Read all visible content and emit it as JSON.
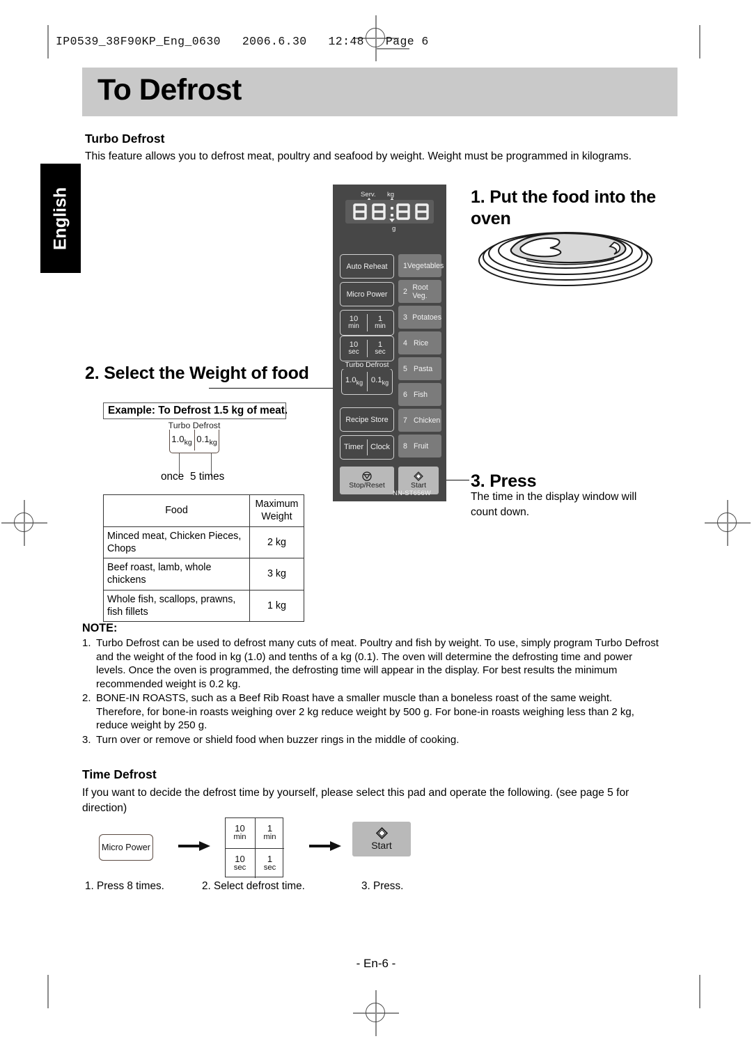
{
  "print_slug": "IP0539_38F90KP_Eng_0630   2006.6.30   12:48   Page 6",
  "page_title": "To Defrost",
  "language_tab": "English",
  "sections": {
    "turbo_defrost_heading": "Turbo Defrost",
    "turbo_defrost_intro": "This feature allows you to defrost meat, poultry and seafood by weight. Weight must be programmed in kilograms.",
    "time_defrost_heading": "Time Defrost",
    "time_defrost_intro": "If you want to decide the defrost time by yourself, please select this pad and operate the following. (see page 5 for direction)"
  },
  "steps": {
    "step1": "1. Put the food into the oven",
    "step2": "2. Select the Weight of food",
    "step3_title": "3. Press",
    "step3_body": "The time in the display window will count down."
  },
  "example": {
    "box_label": "Example: To Defrost 1.5 kg of meat.",
    "key_caption": "Turbo Defrost",
    "key_left": "1.0",
    "key_left_unit": "kg",
    "key_right": "0.1",
    "key_right_unit": "kg",
    "tick_left": "once",
    "tick_right": "5 times"
  },
  "food_table": {
    "headers": [
      "Food",
      "Maximum Weight"
    ],
    "rows": [
      {
        "food": "Minced meat, Chicken Pieces, Chops",
        "weight": "2 kg"
      },
      {
        "food": "Beef roast, lamb, whole chickens",
        "weight": "3 kg"
      },
      {
        "food": "Whole fish, scallops, prawns, fish fillets",
        "weight": "1 kg"
      }
    ]
  },
  "note": {
    "heading": "NOTE:",
    "items": [
      {
        "num": "1.",
        "text": "Turbo Defrost can be used to defrost many cuts of meat. Poultry and fish by weight. To use, simply program Turbo Defrost and the weight of the food in kg (1.0) and tenths of a kg (0.1). The oven will determine the defrosting time and power levels. Once the oven is programmed, the defrosting time will appear in the display. For best results the minimum recommended weight is 0.2 kg."
      },
      {
        "num": "2.",
        "text": "BONE-IN ROASTS, such as a Beef Rib Roast have a smaller muscle than a boneless roast of the same weight. Therefore, for bone-in roasts weighing over 2 kg reduce weight by 500 g. For bone-in roasts weighing less than 2 kg, reduce weight by 250 g."
      },
      {
        "num": "3.",
        "text": "Turn over or remove or shield food when buzzer rings in the middle of cooking."
      }
    ]
  },
  "time_defrost_flow": {
    "micro_power_label": "Micro Power",
    "grid": [
      {
        "value": "10",
        "unit": "min"
      },
      {
        "value": "1",
        "unit": "min"
      },
      {
        "value": "10",
        "unit": "sec"
      },
      {
        "value": "1",
        "unit": "sec"
      }
    ],
    "start_label": "Start",
    "captions": [
      "1. Press 8 times.",
      "2. Select defrost time.",
      "3. Press."
    ]
  },
  "control_panel": {
    "model": "NN-ST656W",
    "display": {
      "digits": "88:88",
      "indicator_serv": "Serv.",
      "indicator_kg": "kg",
      "indicator_g": "g"
    },
    "left_buttons": [
      "Auto Reheat",
      "Micro Power"
    ],
    "time_pads": [
      {
        "value": "10",
        "unit": "min"
      },
      {
        "value": "1",
        "unit": "min"
      },
      {
        "value": "10",
        "unit": "sec"
      },
      {
        "value": "1",
        "unit": "sec"
      }
    ],
    "turbo_defrost": {
      "caption": "Turbo Defrost",
      "left": "1.0",
      "left_unit": "kg",
      "right": "0.1",
      "right_unit": "kg"
    },
    "recipe_store": "Recipe Store",
    "timer": "Timer",
    "clock": "Clock",
    "stop_reset": "Stop/Reset",
    "start": "Start",
    "menu_buttons": [
      {
        "num": "1",
        "label": "Vegetables"
      },
      {
        "num": "2",
        "label": "Root Veg."
      },
      {
        "num": "3",
        "label": "Potatoes"
      },
      {
        "num": "4",
        "label": "Rice"
      },
      {
        "num": "5",
        "label": "Pasta"
      },
      {
        "num": "6",
        "label": "Fish"
      },
      {
        "num": "7",
        "label": "Chicken"
      },
      {
        "num": "8",
        "label": "Fruit"
      }
    ]
  },
  "footer": "- En-6 -",
  "colors": {
    "title_band": "#c9c9c9",
    "panel_body": "#474747",
    "menu_button": "#7b7b7b",
    "start_button": "#b9b9b9",
    "tab_black": "#000000"
  }
}
